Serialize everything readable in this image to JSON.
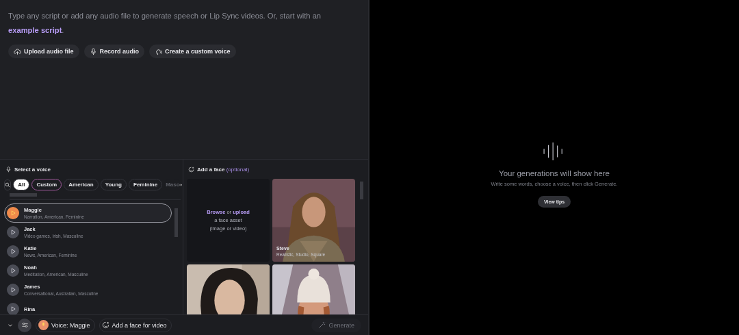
{
  "editor": {
    "prompt": "Type any script or add any audio file to generate speech or Lip Sync videos. Or, start with an",
    "link": "example script",
    "after": "."
  },
  "actions": [
    {
      "label": "Upload audio file",
      "kind": "upload"
    },
    {
      "label": "Record audio",
      "kind": "mic"
    },
    {
      "label": "Create a custom voice",
      "kind": "voice"
    }
  ],
  "voices": {
    "title": "Select a voice",
    "filters": [
      {
        "label": "All",
        "selected": true,
        "kind": "plain"
      },
      {
        "label": "Custom",
        "selected": false,
        "kind": "gradient"
      },
      {
        "label": "American",
        "selected": false,
        "kind": "plain"
      },
      {
        "label": "Young",
        "selected": false,
        "kind": "plain"
      },
      {
        "label": "Feminine",
        "selected": false,
        "kind": "plain"
      },
      {
        "label": "Masc",
        "selected": false,
        "kind": "faded"
      }
    ],
    "items": [
      {
        "name": "Maggie",
        "tags": "Narration, American, Feminine",
        "selected": true
      },
      {
        "name": "Jack",
        "tags": "Video games, Irish, Masculine",
        "selected": false
      },
      {
        "name": "Katie",
        "tags": "News, American, Feminine",
        "selected": false
      },
      {
        "name": "Noah",
        "tags": "Meditation, American, Masculine",
        "selected": false
      },
      {
        "name": "James",
        "tags": "Conversational, Australian, Masculine",
        "selected": false
      },
      {
        "name": "Rina",
        "selected": false
      }
    ]
  },
  "faces": {
    "title": "Add a face",
    "hint": "(optional)",
    "upload": {
      "browse": "Browse",
      "or": "or",
      "upload": "upload",
      "line2": "a face asset",
      "line3": "(image or video)"
    },
    "cards": [
      {
        "kind": "picture",
        "name": "Steve",
        "tags": "Realistic, Studio, Square"
      },
      {
        "kind": "picture"
      },
      {
        "kind": "picture"
      }
    ]
  },
  "bottom": {
    "voice": "Voice: Maggie",
    "face": "Add a face for video",
    "generate": "Generate"
  },
  "output": {
    "title": "Your generations will show here",
    "subtitle": "Write some words, choose a voice, then click Generate.",
    "button": "View tips"
  }
}
